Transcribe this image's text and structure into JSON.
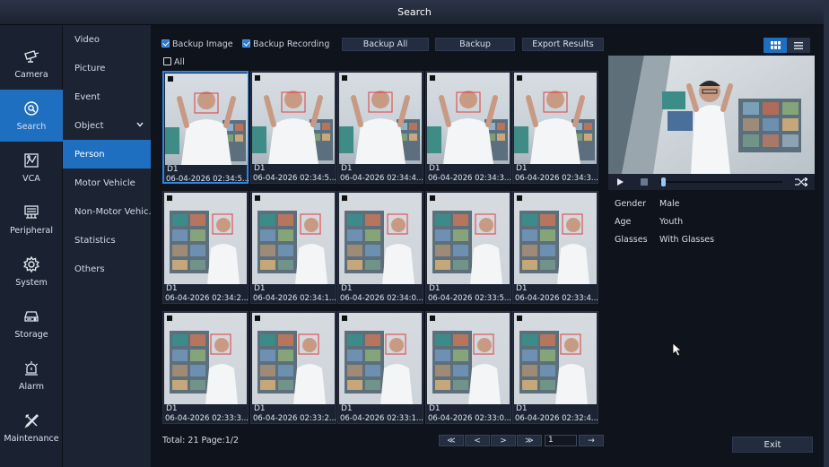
{
  "window": {
    "title": "Search"
  },
  "main_nav": [
    {
      "label": "Camera",
      "icon": "camera-icon"
    },
    {
      "label": "Search",
      "icon": "search-icon",
      "active": true
    },
    {
      "label": "VCA",
      "icon": "vca-icon"
    },
    {
      "label": "Peripheral",
      "icon": "peripheral-icon"
    },
    {
      "label": "System",
      "icon": "gear-icon"
    },
    {
      "label": "Storage",
      "icon": "hdd-icon"
    },
    {
      "label": "Alarm",
      "icon": "alarm-icon"
    },
    {
      "label": "Maintenance",
      "icon": "tools-icon"
    }
  ],
  "sub_nav": [
    {
      "label": "Video"
    },
    {
      "label": "Picture"
    },
    {
      "label": "Event"
    },
    {
      "label": "Object"
    },
    {
      "label": "Person",
      "active": true
    },
    {
      "label": "Motor Vehicle"
    },
    {
      "label": "Non-Motor Vehic.."
    },
    {
      "label": "Statistics"
    },
    {
      "label": "Others"
    }
  ],
  "toolbar": {
    "backup_image": "Backup Image",
    "backup_recording": "Backup Recording",
    "backup_all": "Backup All",
    "backup": "Backup",
    "export_results": "Export Results",
    "select_all": "All"
  },
  "results": [
    {
      "channel": "D1",
      "time": "06-04-2026 02:34:5..."
    },
    {
      "channel": "D1",
      "time": "06-04-2026 02:34:5..."
    },
    {
      "channel": "D1",
      "time": "06-04-2026 02:34:4..."
    },
    {
      "channel": "D1",
      "time": "06-04-2026 02:34:3..."
    },
    {
      "channel": "D1",
      "time": "06-04-2026 02:34:3..."
    },
    {
      "channel": "D1",
      "time": "06-04-2026 02:34:2..."
    },
    {
      "channel": "D1",
      "time": "06-04-2026 02:34:1..."
    },
    {
      "channel": "D1",
      "time": "06-04-2026 02:34:0..."
    },
    {
      "channel": "D1",
      "time": "06-04-2026 02:33:5..."
    },
    {
      "channel": "D1",
      "time": "06-04-2026 02:33:4..."
    },
    {
      "channel": "D1",
      "time": "06-04-2026 02:33:3..."
    },
    {
      "channel": "D1",
      "time": "06-04-2026 02:33:2..."
    },
    {
      "channel": "D1",
      "time": "06-04-2026 02:33:1..."
    },
    {
      "channel": "D1",
      "time": "06-04-2026 02:33:0..."
    },
    {
      "channel": "D1",
      "time": "06-04-2026 02:32:4..."
    }
  ],
  "footer": {
    "summary": "Total: 21  Page:1/2",
    "first": "≪",
    "prev": "<",
    "next": ">",
    "last": "≫",
    "page_value": "1",
    "go": "→"
  },
  "attributes": [
    {
      "label": "Gender",
      "value": "Male"
    },
    {
      "label": "Age",
      "value": "Youth"
    },
    {
      "label": "Glasses",
      "value": "With Glasses"
    }
  ],
  "exit_label": "Exit",
  "colors": {
    "accent": "#1f6fc0",
    "panel": "#1c2433",
    "background": "#0f131b"
  }
}
